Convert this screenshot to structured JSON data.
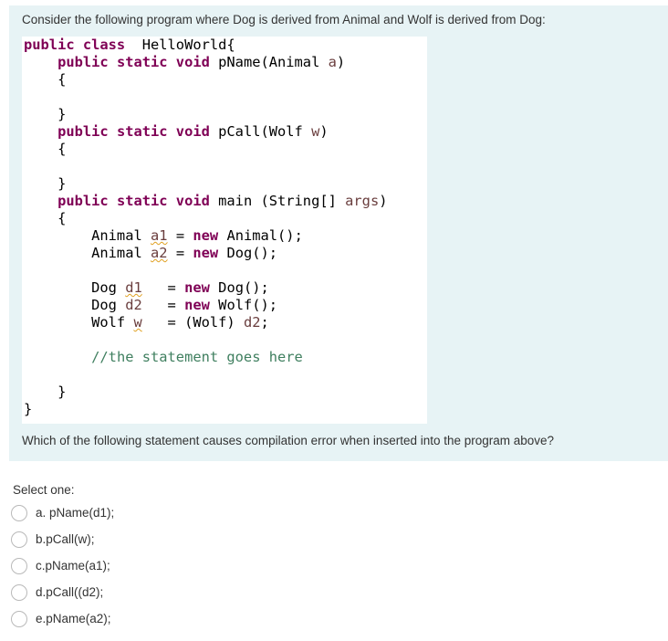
{
  "question": {
    "intro": "Consider the following program where Dog is derived from Animal and Wolf is derived from Dog:",
    "code_lines": [
      [
        {
          "t": "public class",
          "c": "kw"
        },
        {
          "t": "  HelloWorld{"
        }
      ],
      [
        {
          "t": "    "
        },
        {
          "t": "public static void",
          "c": "kw"
        },
        {
          "t": " pName(Animal "
        },
        {
          "t": "a",
          "c": "var"
        },
        {
          "t": ")"
        }
      ],
      [
        {
          "t": "    {"
        }
      ],
      [
        {
          "t": ""
        }
      ],
      [
        {
          "t": "    }"
        }
      ],
      [
        {
          "t": "    "
        },
        {
          "t": "public static void",
          "c": "kw"
        },
        {
          "t": " pCall(Wolf "
        },
        {
          "t": "w",
          "c": "var"
        },
        {
          "t": ")"
        }
      ],
      [
        {
          "t": "    {"
        }
      ],
      [
        {
          "t": ""
        }
      ],
      [
        {
          "t": "    }"
        }
      ],
      [
        {
          "t": "    "
        },
        {
          "t": "public static void",
          "c": "kw"
        },
        {
          "t": " main (String[] "
        },
        {
          "t": "args",
          "c": "var"
        },
        {
          "t": ")"
        }
      ],
      [
        {
          "t": "    {"
        }
      ],
      [
        {
          "t": "        Animal "
        },
        {
          "t": "a1",
          "c": "var warn"
        },
        {
          "t": " = "
        },
        {
          "t": "new",
          "c": "kw"
        },
        {
          "t": " Animal();"
        }
      ],
      [
        {
          "t": "        Animal "
        },
        {
          "t": "a2",
          "c": "var warn"
        },
        {
          "t": " = "
        },
        {
          "t": "new",
          "c": "kw"
        },
        {
          "t": " Dog();"
        }
      ],
      [
        {
          "t": ""
        }
      ],
      [
        {
          "t": "        Dog "
        },
        {
          "t": "d1",
          "c": "var warn"
        },
        {
          "t": "   = "
        },
        {
          "t": "new",
          "c": "kw"
        },
        {
          "t": " Dog();"
        }
      ],
      [
        {
          "t": "        Dog "
        },
        {
          "t": "d2",
          "c": "var"
        },
        {
          "t": "   = "
        },
        {
          "t": "new",
          "c": "kw"
        },
        {
          "t": " Wolf();"
        }
      ],
      [
        {
          "t": "        Wolf "
        },
        {
          "t": "w",
          "c": "var warn"
        },
        {
          "t": "   = (Wolf) "
        },
        {
          "t": "d2",
          "c": "var"
        },
        {
          "t": ";"
        }
      ],
      [
        {
          "t": ""
        }
      ],
      [
        {
          "t": "        "
        },
        {
          "t": "//the statement goes here",
          "c": "cmt"
        }
      ],
      [
        {
          "t": ""
        }
      ],
      [
        {
          "t": "    }"
        }
      ],
      [
        {
          "t": "}"
        }
      ]
    ],
    "prompt": "Which of the following statement causes compilation error when inserted into the program above?"
  },
  "answers": {
    "label": "Select one:",
    "options": [
      {
        "text": "a. pName(d1);"
      },
      {
        "text": "b.pCall(w);"
      },
      {
        "text": "c.pName(a1);"
      },
      {
        "text": "d.pCall((d2);"
      },
      {
        "text": "e.pName(a2);"
      }
    ]
  }
}
